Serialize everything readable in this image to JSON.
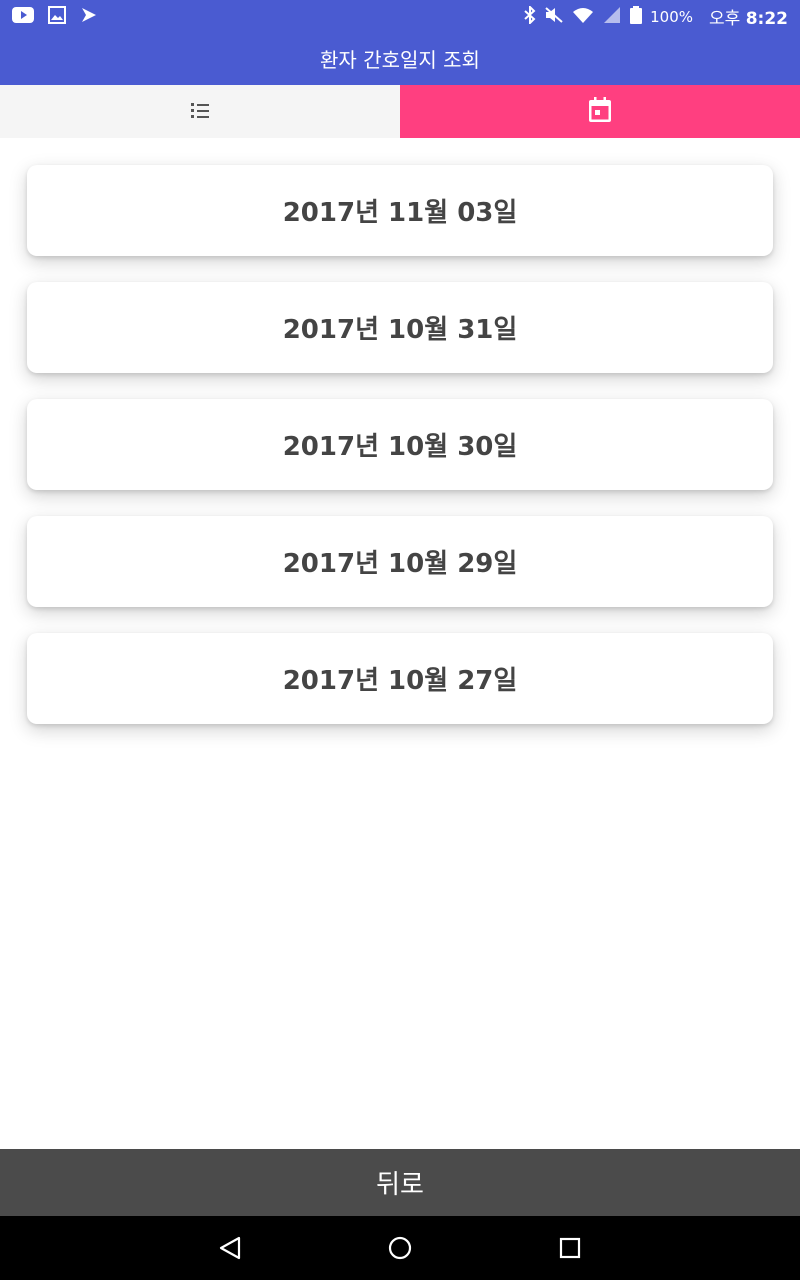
{
  "status_bar": {
    "battery": "100%",
    "time_prefix": "오후",
    "time": "8:22",
    "icons_left": [
      "youtube-icon",
      "gallery-icon",
      "app-icon"
    ],
    "icons_right": [
      "bluetooth-icon",
      "mute-icon",
      "wifi-icon",
      "signal-icon",
      "battery-icon"
    ]
  },
  "app": {
    "title": "환자 간호일지 조회"
  },
  "tabs": [
    {
      "icon": "list-icon",
      "selected": false
    },
    {
      "icon": "calendar-icon",
      "selected": true,
      "accent": "#ff3f80"
    }
  ],
  "dates": [
    {
      "label": "2017년 11월 03일"
    },
    {
      "label": "2017년 10월 31일"
    },
    {
      "label": "2017년 10월 30일"
    },
    {
      "label": "2017년 10월 29일"
    },
    {
      "label": "2017년 10월 27일"
    }
  ],
  "back_button": {
    "label": "뒤로"
  },
  "nav": {
    "buttons": [
      "back-icon",
      "home-icon",
      "recents-icon"
    ]
  },
  "colors": {
    "header": "#4a5bd1",
    "accent": "#ff3f80",
    "back_bar": "#4b4b4b"
  }
}
